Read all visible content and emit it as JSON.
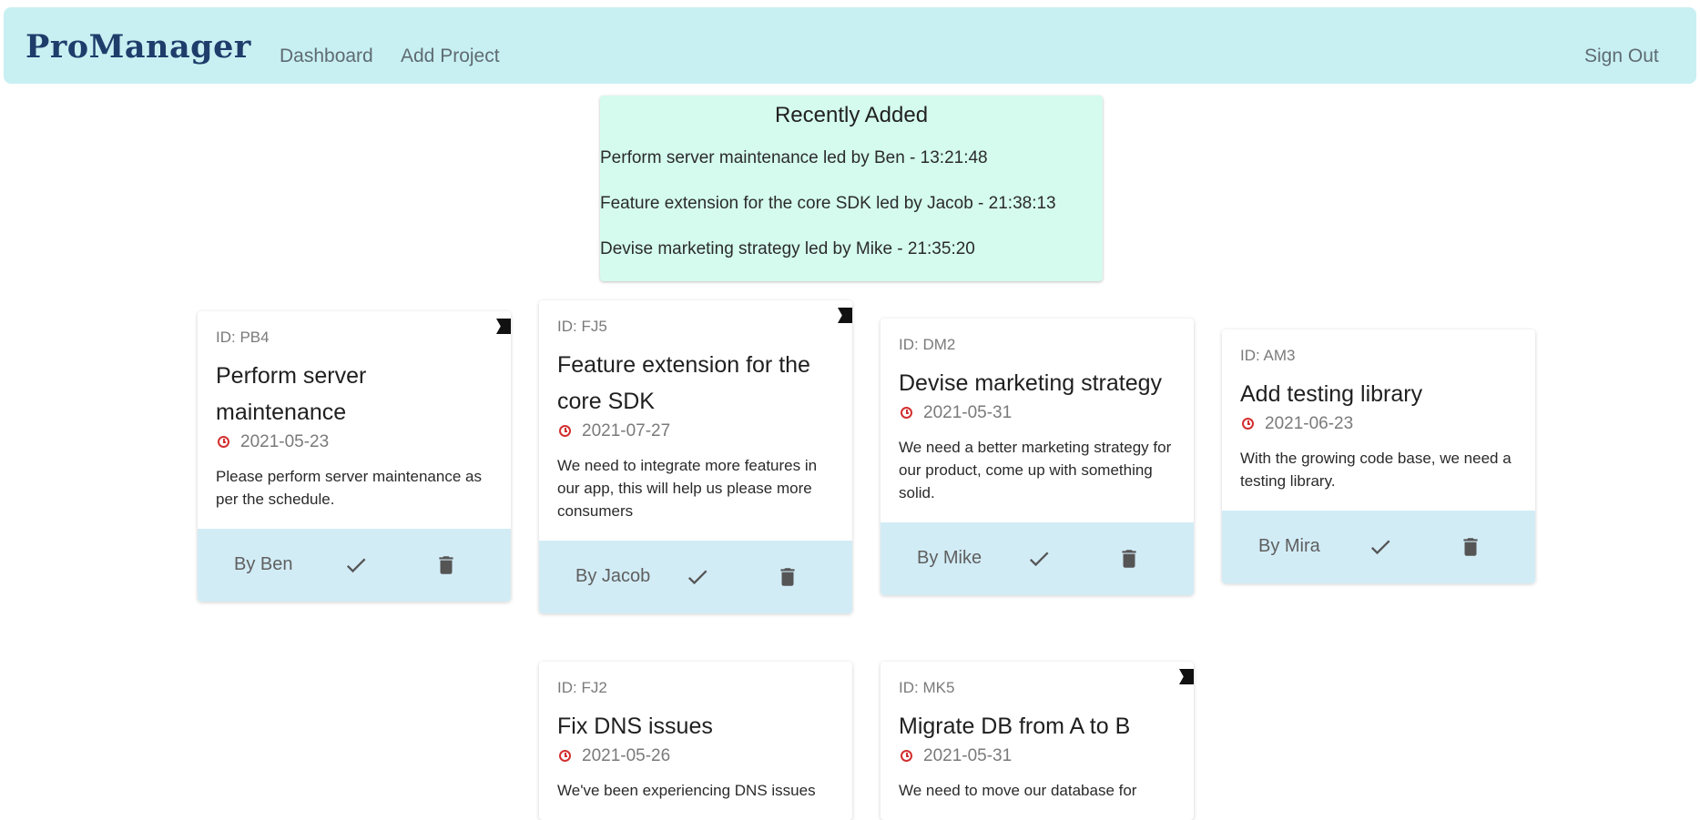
{
  "navbar": {
    "brand": "ProManager",
    "links": [
      "Dashboard",
      "Add Project"
    ],
    "sign_out": "Sign Out",
    "color": "#c8f0f2"
  },
  "recent": {
    "title": "Recently Added",
    "items": [
      "Perform server maintenance led by Ben - 13:21:48",
      "Feature extension for the core SDK led by Jacob - 21:38:13",
      "Devise marketing strategy led by Mike - 21:35:20"
    ],
    "color": "#d4fbee"
  },
  "cards": [
    {
      "id": "ID: PB4",
      "title": "Perform server maintenance",
      "date": "2021-05-23",
      "desc": "Please perform server maintenance as per the schedule.",
      "by": "By Ben",
      "flagged": true
    },
    {
      "id": "ID: FJ5",
      "title": "Feature extension for the core SDK",
      "date": "2021-07-27",
      "desc": "We need to integrate more features in our app, this will help us please more consumers",
      "by": "By Jacob",
      "flagged": true
    },
    {
      "id": "ID: DM2",
      "title": "Devise marketing strategy",
      "date": "2021-05-31",
      "desc": "We need a better marketing strategy for our product, come up with something solid.",
      "by": "By Mike",
      "flagged": false
    },
    {
      "id": "ID: AM3",
      "title": "Add testing library",
      "date": "2021-06-23",
      "desc": "With the growing code base, we need a testing library.",
      "by": "By Mira",
      "flagged": false
    },
    {
      "id": "ID: FJ2",
      "title": "Fix DNS issues",
      "date": "2021-05-26",
      "desc": "We've been experiencing DNS issues",
      "by": "",
      "flagged": false
    },
    {
      "id": "ID: MK5",
      "title": "Migrate DB from A to B",
      "date": "2021-05-31",
      "desc": "We need to move our database for",
      "by": "",
      "flagged": true
    }
  ],
  "icons": {
    "flag": "flag-icon",
    "clock": "clock-icon",
    "check": "check-icon",
    "trash": "trash-icon"
  },
  "colors": {
    "card_footer": "#d2ecf6",
    "clock": "#d32f2f",
    "brand": "#1f3d6b"
  }
}
